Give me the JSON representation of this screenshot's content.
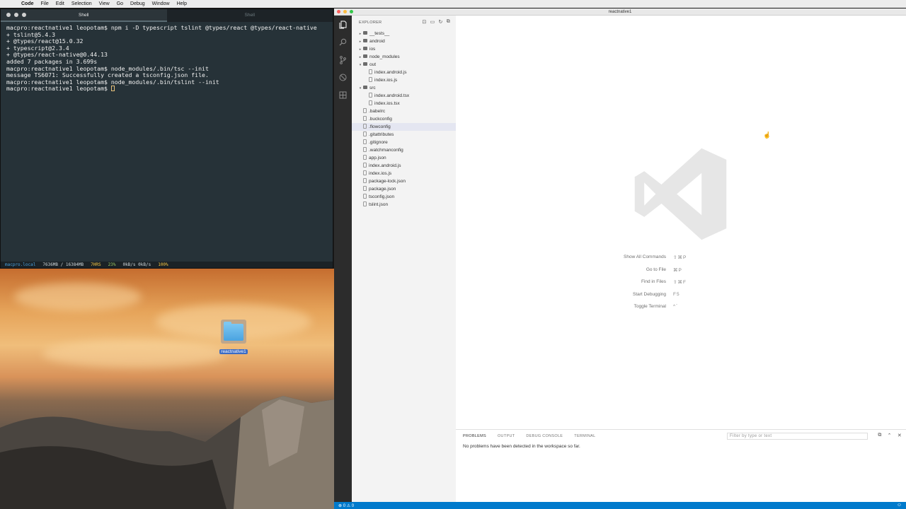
{
  "menubar": {
    "app": "Code",
    "items": [
      "File",
      "Edit",
      "Selection",
      "View",
      "Go",
      "Debug",
      "Window",
      "Help"
    ]
  },
  "terminal": {
    "tabs": [
      {
        "label": "Shell",
        "active": true
      },
      {
        "label": "Shell",
        "active": false
      }
    ],
    "lines": [
      "macpro:reactnative1 leopotam$ npm i -D typescript tslint @types/react @types/react-native",
      "+ tslint@5.4.3",
      "+ @types/react@15.0.32",
      "+ typescript@2.3.4",
      "+ @types/react-native@0.44.13",
      "added 7 packages in 3.699s",
      "macpro:reactnative1 leopotam$ node_modules/.bin/tsc --init",
      "message TS6071: Successfully created a tsconfig.json file.",
      "macpro:reactnative1 leopotam$ node_modules/.bin/tslint --init"
    ],
    "prompt": "macpro:reactnative1 leopotam$ ",
    "status": {
      "host": "macpro.local",
      "memory": "7636MB / 16384MB",
      "uptime": "7HRS",
      "cpu": "23%",
      "network": "0kB/s 0kB/s",
      "battery": "100%"
    }
  },
  "desktop": {
    "folder_label": "reactnative1"
  },
  "vscode": {
    "title": "reactnative1",
    "explorer": {
      "heading": "EXPLORER",
      "tree": [
        {
          "label": "__tests__",
          "type": "folder",
          "depth": 0,
          "expanded": false
        },
        {
          "label": "android",
          "type": "folder",
          "depth": 0,
          "expanded": false
        },
        {
          "label": "ios",
          "type": "folder",
          "depth": 0,
          "expanded": false
        },
        {
          "label": "node_modules",
          "type": "folder",
          "depth": 0,
          "expanded": false
        },
        {
          "label": "out",
          "type": "folder",
          "depth": 0,
          "expanded": true
        },
        {
          "label": "index.android.js",
          "type": "file",
          "depth": 1
        },
        {
          "label": "index.ios.js",
          "type": "file",
          "depth": 1
        },
        {
          "label": "src",
          "type": "folder",
          "depth": 0,
          "expanded": true
        },
        {
          "label": "index.android.tsx",
          "type": "file",
          "depth": 1
        },
        {
          "label": "index.ios.tsx",
          "type": "file",
          "depth": 1
        },
        {
          "label": ".babelrc",
          "type": "file",
          "depth": 0
        },
        {
          "label": ".buckconfig",
          "type": "file",
          "depth": 0
        },
        {
          "label": ".flowconfig",
          "type": "file",
          "depth": 0,
          "hover": true
        },
        {
          "label": ".gitattributes",
          "type": "file",
          "depth": 0
        },
        {
          "label": ".gitignore",
          "type": "file",
          "depth": 0
        },
        {
          "label": ".watchmanconfig",
          "type": "file",
          "depth": 0
        },
        {
          "label": "app.json",
          "type": "file",
          "depth": 0
        },
        {
          "label": "index.android.js",
          "type": "file",
          "depth": 0
        },
        {
          "label": "index.ios.js",
          "type": "file",
          "depth": 0
        },
        {
          "label": "package-lock.json",
          "type": "file",
          "depth": 0
        },
        {
          "label": "package.json",
          "type": "file",
          "depth": 0
        },
        {
          "label": "tsconfig.json",
          "type": "file",
          "depth": 0
        },
        {
          "label": "tslint.json",
          "type": "file",
          "depth": 0
        }
      ]
    },
    "shortcuts": [
      {
        "label": "Show All Commands",
        "keys": "⇧⌘P"
      },
      {
        "label": "Go to File",
        "keys": "⌘P"
      },
      {
        "label": "Find in Files",
        "keys": "⇧⌘F"
      },
      {
        "label": "Start Debugging",
        "keys": "F5"
      },
      {
        "label": "Toggle Terminal",
        "keys": "^`"
      }
    ],
    "panel": {
      "tabs": [
        "PROBLEMS",
        "OUTPUT",
        "DEBUG CONSOLE",
        "TERMINAL"
      ],
      "active_tab": "PROBLEMS",
      "filter_placeholder": "Filter by type or text",
      "message": "No problems have been detected in the workspace so far."
    },
    "statusbar": {
      "errors": "0",
      "warnings": "0"
    },
    "colors": {
      "accent": "#007acc",
      "activitybar": "#2c2c2c",
      "sidebar": "#f3f3f3"
    }
  }
}
